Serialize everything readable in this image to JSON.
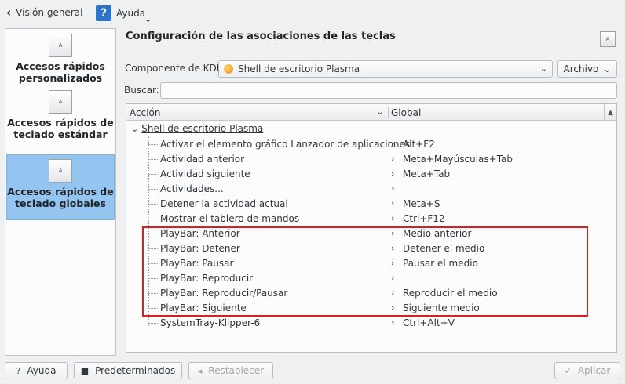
{
  "toolbar": {
    "back_label": "Visión general",
    "help_label": "Ayuda",
    "help_icon_glyph": "?"
  },
  "sidebar": {
    "items": [
      {
        "label": "Accesos rápidos personalizados",
        "icon": "A"
      },
      {
        "label": "Accesos rápidos de teclado estándar",
        "icon": "A"
      },
      {
        "label": "Accesos rápidos de teclado globales",
        "icon": "A"
      }
    ],
    "active_index": 2
  },
  "main": {
    "title": "Configuración de las asociaciones de las teclas",
    "title_button_icon": "A",
    "component_label": "Componente de KDE:",
    "component_value": "Shell de escritorio Plasma",
    "archivo_label": "Archivo",
    "search_label": "Buscar:",
    "search_value": ""
  },
  "tree": {
    "headers": {
      "action": "Acción",
      "global": "Global"
    },
    "root_label": "Shell de escritorio Plasma",
    "rows": [
      {
        "action": "Activar el elemento gráfico Lanzador de aplicaciones",
        "global": "Alt+F2"
      },
      {
        "action": "Actividad anterior",
        "global": "Meta+Mayúsculas+Tab"
      },
      {
        "action": "Actividad siguiente",
        "global": "Meta+Tab"
      },
      {
        "action": "Actividades...",
        "global": ""
      },
      {
        "action": "Detener la actividad actual",
        "global": "Meta+S"
      },
      {
        "action": "Mostrar el tablero de mandos",
        "global": "Ctrl+F12"
      },
      {
        "action": "PlayBar: Anterior",
        "global": "Medio anterior"
      },
      {
        "action": "PlayBar: Detener",
        "global": "Detener el medio"
      },
      {
        "action": "PlayBar: Pausar",
        "global": "Pausar el medio"
      },
      {
        "action": "PlayBar: Reproducir",
        "global": ""
      },
      {
        "action": "PlayBar: Reproducir/Pausar",
        "global": "Reproducir el medio"
      },
      {
        "action": "PlayBar: Siguiente",
        "global": "Siguiente medio"
      },
      {
        "action": "SystemTray-Klipper-6",
        "global": "Ctrl+Alt+V"
      }
    ]
  },
  "buttons": {
    "help": "Ayuda",
    "defaults": "Predeterminados",
    "reset": "Restablecer",
    "apply": "Aplicar"
  },
  "colors": {
    "selection": "#93c5f0",
    "highlight_box": "#e31b1b",
    "help_icon": "#2b74c7"
  }
}
